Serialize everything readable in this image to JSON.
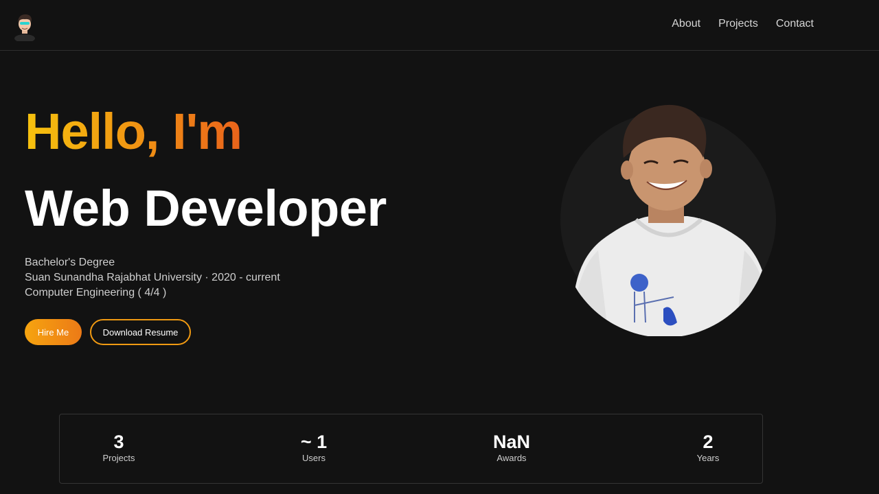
{
  "nav": {
    "avatar_icon": "cartoon-avatar-icon",
    "links": [
      "About",
      "Projects",
      "Contact"
    ]
  },
  "hero": {
    "greeting": "Hello, I'm",
    "role": "Web Developer",
    "education": [
      "Bachelor's Degree",
      "Suan Sunandha Rajabhat University · 2020 - current",
      "Computer Engineering ( 4/4 )"
    ],
    "hire_label": "Hire Me",
    "resume_label": "Download Resume",
    "gradient_colors": [
      "#f6c20e",
      "#f19a12",
      "#e9631b"
    ]
  },
  "stats": [
    {
      "value": "3",
      "label": "Projects"
    },
    {
      "value": "~ 1",
      "label": "Users"
    },
    {
      "value": "NaN",
      "label": "Awards"
    },
    {
      "value": "2",
      "label": "Years"
    }
  ],
  "colors": {
    "background": "#121212",
    "accent": "#f19a12"
  }
}
